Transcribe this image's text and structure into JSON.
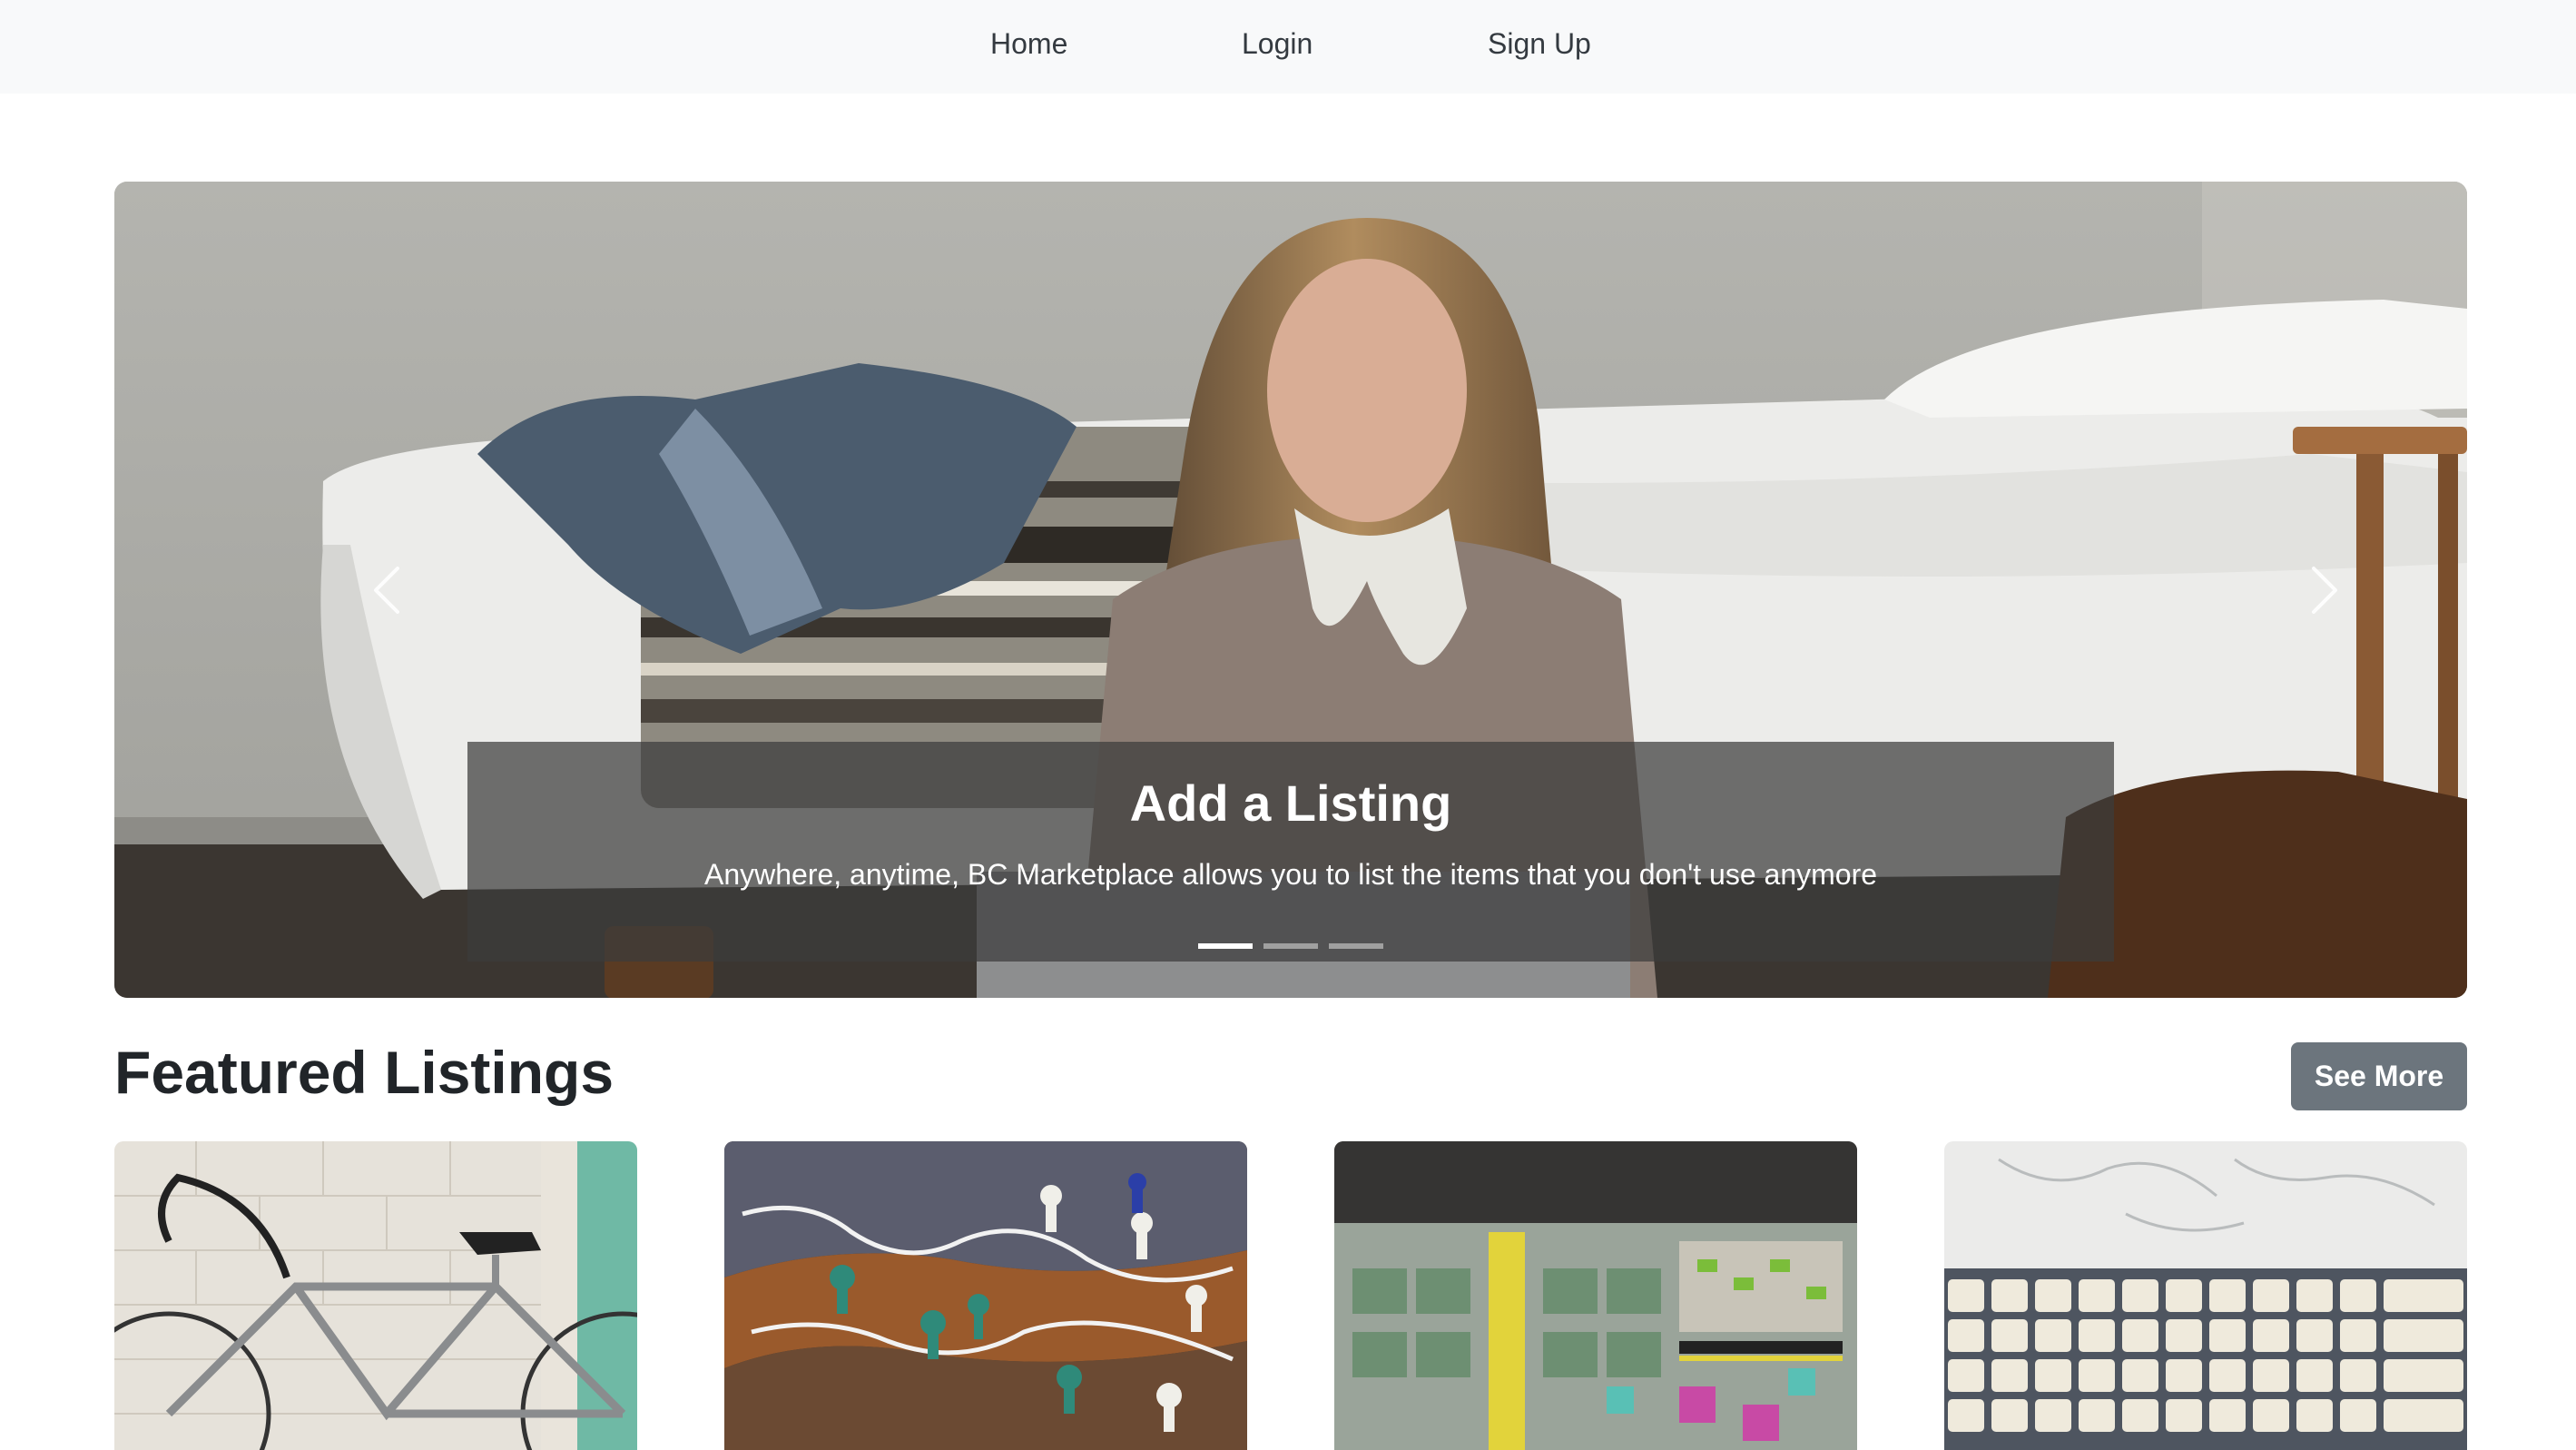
{
  "nav": {
    "home": "Home",
    "login": "Login",
    "signup": "Sign Up"
  },
  "carousel": {
    "slides": [
      {
        "title": "Add a Listing",
        "text": "Anywhere, anytime, BC Marketplace allows you to list the items that you don't use anymore"
      }
    ],
    "active_index": 0,
    "indicator_count": 3,
    "prev_icon": "chevron-left-icon",
    "next_icon": "chevron-right-icon"
  },
  "featured": {
    "title": "Featured Listings",
    "see_more": "See More",
    "cards": [
      {
        "image": "bicycle-photo"
      },
      {
        "image": "board-game-miniatures-photo"
      },
      {
        "image": "board-game-tiles-photo"
      },
      {
        "image": "keyboard-photo"
      }
    ]
  },
  "colors": {
    "navbar_bg": "#f8f9fa",
    "button_secondary": "#6c757d",
    "text_dark": "#212529",
    "caption_bg": "rgba(60,60,60,0.72)"
  }
}
